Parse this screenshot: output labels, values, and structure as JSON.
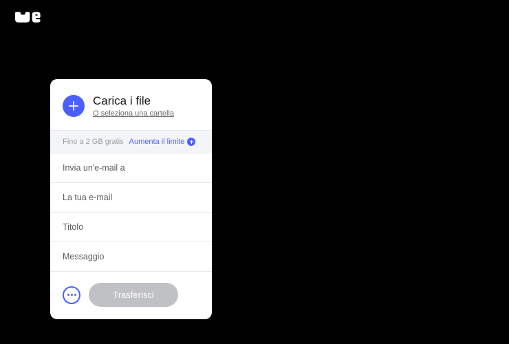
{
  "upload": {
    "title": "Carica i file",
    "subtitle": "O seleziona una cartella"
  },
  "limit": {
    "text": "Fino a 2 GB gratis",
    "link": "Aumenta il limite"
  },
  "fields": {
    "emailTo": "Invia un'e-mail a",
    "yourEmail": "La tua e-mail",
    "title": "Titolo",
    "message": "Messaggio"
  },
  "transfer": "Trasferisci"
}
